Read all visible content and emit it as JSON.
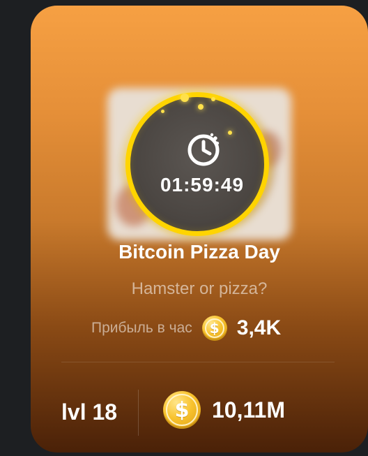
{
  "card": {
    "timer": "01:59:49",
    "title": "Bitcoin Pizza Day",
    "subtitle": "Hamster or pizza?",
    "profit_label": "Прибыль в час",
    "profit_value": "3,4K",
    "level": "lvl 18",
    "balance": "10,11M"
  },
  "icons": {
    "timer": "timer-icon",
    "coin": "coin-icon"
  },
  "colors": {
    "accent": "#ffd400",
    "card_top": "#f6a043",
    "card_bottom": "#4a2108",
    "coin": "#f8c22d",
    "text": "#ffffff"
  }
}
